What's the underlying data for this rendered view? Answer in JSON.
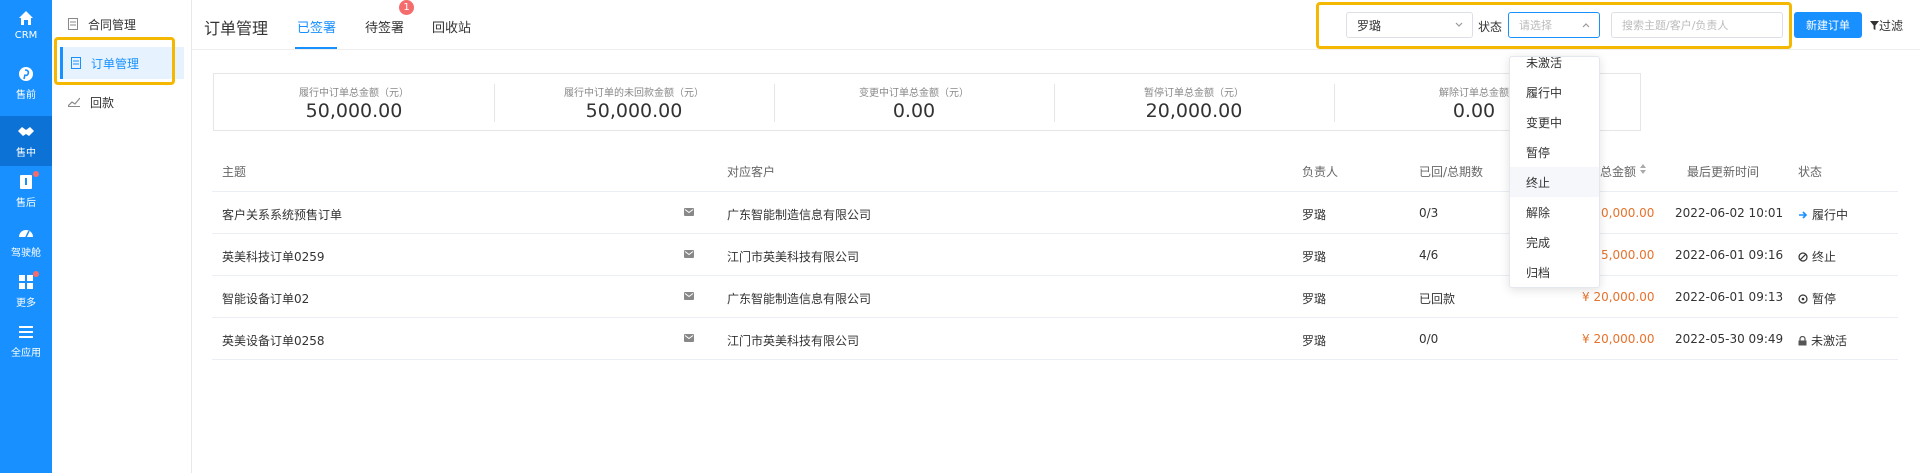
{
  "rail": {
    "items": [
      {
        "label": "CRM",
        "icon": "home-icon"
      },
      {
        "label": "售前",
        "icon": "pinterest-icon"
      },
      {
        "label": "售中",
        "icon": "handshake-icon"
      },
      {
        "label": "售后",
        "icon": "after-sales-icon"
      },
      {
        "label": "驾驶舱",
        "icon": "dashboard-icon"
      },
      {
        "label": "更多",
        "icon": "grid-icon"
      },
      {
        "label": "全应用",
        "icon": "menu-icon"
      }
    ]
  },
  "submenu": {
    "items": [
      {
        "label": "合同管理"
      },
      {
        "label": "订单管理"
      },
      {
        "label": "回款"
      }
    ]
  },
  "header": {
    "title": "订单管理",
    "tabs": [
      {
        "label": "已签署"
      },
      {
        "label": "待签署"
      },
      {
        "label": "回收站"
      }
    ],
    "badge_count": "1",
    "owner_select": "罗璐",
    "status_label": "状态",
    "status_placeholder": "请选择",
    "search_placeholder": "搜索主题/客户/负责人",
    "new_button": "新建订单",
    "filter_button": "过滤"
  },
  "summary": [
    {
      "label": "履行中订单总金额（元）",
      "value": "50,000.00"
    },
    {
      "label": "履行中订单的未回款金额（元）",
      "value": "50,000.00"
    },
    {
      "label": "变更中订单总金额（元）",
      "value": "0.00"
    },
    {
      "label": "暂停订单总金额（元）",
      "value": "20,000.00"
    },
    {
      "label": "解除订单总金额",
      "value": "0.00"
    }
  ],
  "table": {
    "headers": {
      "subject": "主题",
      "customer": "对应客户",
      "owner": "负责人",
      "periods": "已回/总期数",
      "amount": "总金额",
      "updated": "最后更新时间",
      "status": "状态"
    },
    "rows": [
      {
        "subject": "客户关系系统预售订单",
        "customer": "广东智能制造信息有限公司",
        "owner": "罗璐",
        "periods": "0/3",
        "amount": "0,000.00",
        "updated": "2022-06-02 10:01",
        "status": "履行中"
      },
      {
        "subject": "英美科技订单0259",
        "customer": "江门市英美科技有限公司",
        "owner": "罗璐",
        "periods": "4/6",
        "amount": "5,000.00",
        "updated": "2022-06-01 09:16",
        "status": "终止"
      },
      {
        "subject": "智能设备订单02",
        "customer": "广东智能制造信息有限公司",
        "owner": "罗璐",
        "periods": "已回款",
        "amount": "¥ 20,000.00",
        "updated": "2022-06-01 09:13",
        "status": "暂停"
      },
      {
        "subject": "英美设备订单0258",
        "customer": "江门市英美科技有限公司",
        "owner": "罗璐",
        "periods": "0/0",
        "amount": "¥ 20,000.00",
        "updated": "2022-05-30 09:49",
        "status": "未激活"
      }
    ]
  },
  "dropdown": {
    "options": [
      "未激活",
      "履行中",
      "变更中",
      "暂停",
      "终止",
      "解除",
      "完成",
      "归档"
    ]
  },
  "colors": {
    "primary": "#1890ff",
    "highlight": "#f5b800",
    "amount": "#e6722c",
    "badge": "#f56c6c"
  }
}
